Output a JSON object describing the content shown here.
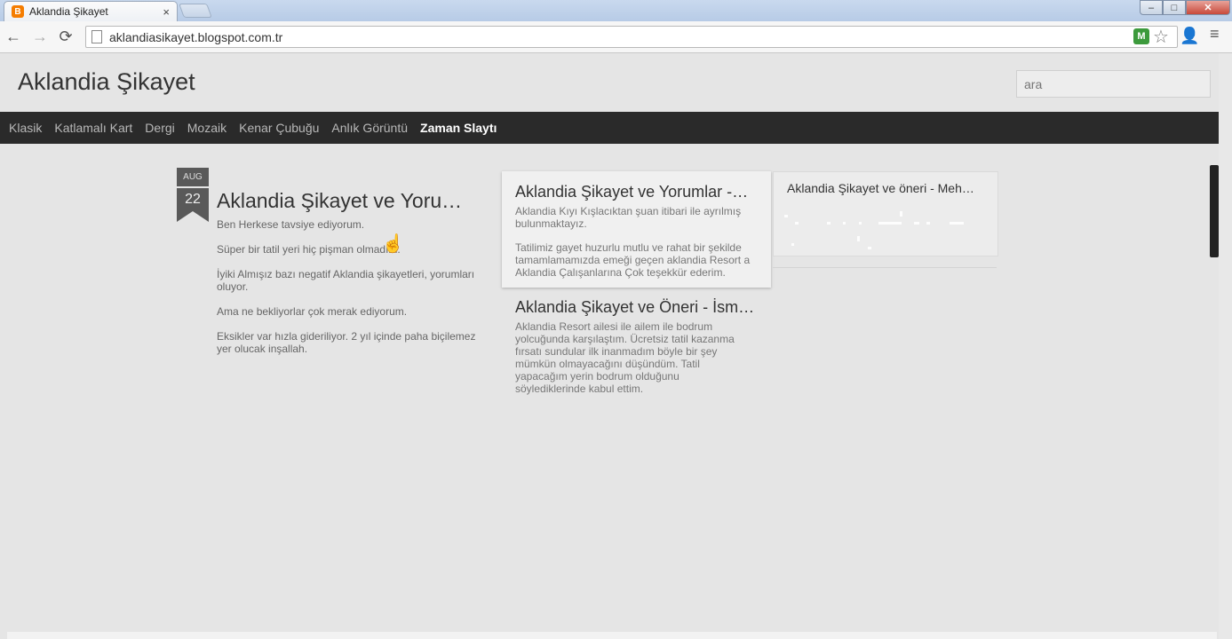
{
  "browser": {
    "tab_title": "Aklandia Şikayet",
    "tab_favicon_letter": "B",
    "tab_close": "×",
    "url": "aklandiasikayet.blogspot.com.tr",
    "controls": {
      "minimize": "–",
      "maximize": "□",
      "close": "✕"
    },
    "nav": {
      "back": "←",
      "forward": "→",
      "reload": "⟳"
    },
    "icons": {
      "extension": "M",
      "star": "☆",
      "person": "👤",
      "menu": "≡"
    }
  },
  "blog": {
    "title": "Aklandia Şikayet",
    "search_placeholder": "ara",
    "nav_items": [
      "Klasik",
      "Katlamalı Kart",
      "Dergi",
      "Mozaik",
      "Kenar Çubuğu",
      "Anlık Görüntü",
      "Zaman Slaytı"
    ],
    "active_nav_index": 6
  },
  "main_post": {
    "month": "AUG",
    "day": "22",
    "title": "Aklandia Şikayet ve Yoru…",
    "paragraphs": [
      "Ben Herkese tavsiye ediyorum.",
      "Süper bir tatil yeri hiç pişman olmadım.",
      "İyiki Almışız bazı negatif Aklandia şikayetleri, yorumları oluyor.",
      "Ama ne bekliyorlar çok merak ediyorum.",
      "Eksikler var hızla gideriliyor. 2 yıl içinde paha biçilemez yer olucak inşallah."
    ]
  },
  "cards": [
    {
      "title": "Aklandia Şikayet ve Yorumlar -…",
      "paragraphs": [
        "Aklandia Kıyı Kışlacıktan şuan itibari ile ayrılmış bulunmaktayız.",
        "Tatilimiz gayet huzurlu mutlu ve rahat bir şekilde tamamlamamızda emeği geçen aklandia Resort a Aklandia Çalışanlarına Çok teşekkür ederim."
      ]
    },
    {
      "title": "Aklandia Şikayet ve Öneri - İsm…",
      "paragraphs": [
        "Aklandia Resort ailesi ile ailem ile bodrum yolcuğunda karşılaştım. Ücretsiz tatil kazanma fırsatı sundular ilk inanmadım böyle bir şey mümkün olmayacağını düşündüm. Tatil yapacağım yerin bodrum olduğunu söylediklerinde kabul ettim."
      ]
    },
    {
      "title": "Aklandia Şikayet ve öneri - Meh…",
      "paragraphs": []
    }
  ]
}
